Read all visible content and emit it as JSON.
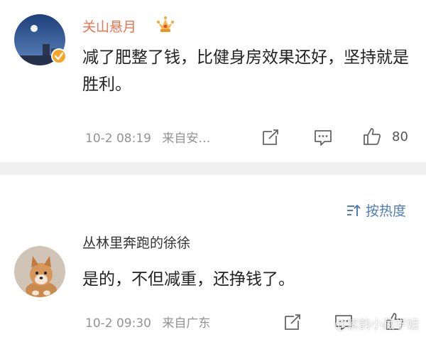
{
  "comments": [
    {
      "username": "关山悬月",
      "content": "减了肥整了钱，比健身房效果还好，坚持就是胜利。",
      "time": "10-2 08:19",
      "location": "来自安…",
      "like_count": "80"
    },
    {
      "username": "丛林里奔跑的徐徐",
      "content": "是的，不但减重，还挣钱了。",
      "time": "10-2 09:30",
      "location": "来自广东"
    }
  ],
  "sort": {
    "label": "按热度"
  },
  "watermark": {
    "text": "@紫韵小藏学姐"
  },
  "colors": {
    "username_vip": "#eb7350",
    "link_blue": "#4f7db8",
    "meta_gray": "#939393",
    "separator": "#f0f0f0"
  },
  "icons": [
    "vip-crown-icon",
    "verified-badge-icon",
    "repost-icon",
    "comment-icon",
    "like-icon",
    "sort-icon"
  ]
}
